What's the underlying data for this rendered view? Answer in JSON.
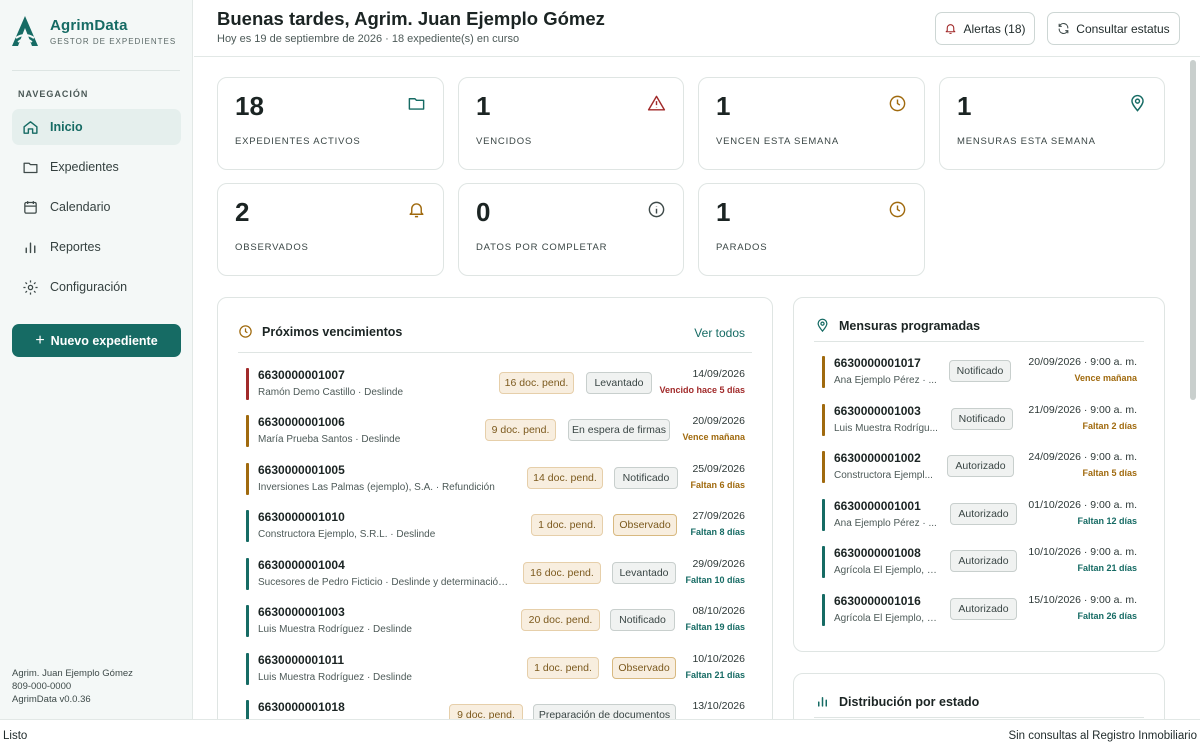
{
  "brand": {
    "name": "AgrimData",
    "subtitle": "GESTOR DE EXPEDIENTES"
  },
  "nav": {
    "title": "NAVEGACIÓN",
    "items": [
      {
        "label": "Inicio",
        "icon": "home-icon",
        "active": true
      },
      {
        "label": "Expedientes",
        "icon": "folder-icon"
      },
      {
        "label": "Calendario",
        "icon": "calendar-icon"
      },
      {
        "label": "Reportes",
        "icon": "bar-chart-icon"
      },
      {
        "label": "Configuración",
        "icon": "gear-icon"
      }
    ],
    "new_button": "Nuevo expediente"
  },
  "sidebar_footer": {
    "user": "Agrim. Juan Ejemplo Gómez",
    "phone": "809-000-0000",
    "version": "AgrimData v0.0.36"
  },
  "header": {
    "greeting": "Buenas tardes, Agrim. Juan Ejemplo Gómez",
    "subtitle": "Hoy es 19 de septiembre de 2026 · 18 expediente(s) en curso",
    "alerts_button": "Alertas (18)",
    "status_button": "Consultar estatus"
  },
  "stats": [
    {
      "value": "18",
      "label": "EXPEDIENTES ACTIVOS",
      "icon": "folder-icon"
    },
    {
      "value": "1",
      "label": "VENCIDOS",
      "icon": "warning-icon"
    },
    {
      "value": "1",
      "label": "VENCEN ESTA SEMANA",
      "icon": "clock-icon"
    },
    {
      "value": "1",
      "label": "MENSURAS ESTA SEMANA",
      "icon": "map-pin-icon"
    },
    {
      "value": "2",
      "label": "OBSERVADOS",
      "icon": "bell-icon"
    },
    {
      "value": "0",
      "label": "DATOS POR COMPLETAR",
      "icon": "info-icon"
    },
    {
      "value": "1",
      "label": "PARADOS",
      "icon": "clock-icon"
    }
  ],
  "upcoming": {
    "title": "Próximos vencimientos",
    "link": "Ver todos",
    "rows": [
      {
        "code": "6630000001007",
        "desc": "Ramón Demo Castillo · Deslinde",
        "docs": "16 doc. pend.",
        "state": "Levantado",
        "date": "14/09/2026",
        "due": "Vencido hace 5 días",
        "tone": "red"
      },
      {
        "code": "6630000001006",
        "desc": "María Prueba Santos · Deslinde",
        "docs": "9 doc. pend.",
        "state": "En espera de firmas",
        "date": "20/09/2026",
        "due": "Vence mañana",
        "tone": "amber"
      },
      {
        "code": "6630000001005",
        "desc": "Inversiones Las Palmas (ejemplo), S.A. · Refundición",
        "docs": "14 doc. pend.",
        "state": "Notificado",
        "date": "25/09/2026",
        "due": "Faltan 6 días",
        "tone": "amber"
      },
      {
        "code": "6630000001010",
        "desc": "Constructora Ejemplo, S.R.L. · Deslinde",
        "docs": "1 doc. pend.",
        "state": "Observado",
        "date": "27/09/2026",
        "due": "Faltan 8 días",
        "tone": "teal"
      },
      {
        "code": "6630000001004",
        "desc": "Sucesores de Pedro Ficticio · Deslinde y determinación ...",
        "docs": "16 doc. pend.",
        "state": "Levantado",
        "date": "29/09/2026",
        "due": "Faltan 10 días",
        "tone": "teal"
      },
      {
        "code": "6630000001003",
        "desc": "Luis Muestra Rodríguez · Deslinde",
        "docs": "20 doc. pend.",
        "state": "Notificado",
        "date": "08/10/2026",
        "due": "Faltan 19 días",
        "tone": "teal"
      },
      {
        "code": "6630000001011",
        "desc": "Luis Muestra Rodríguez · Deslinde",
        "docs": "1 doc. pend.",
        "state": "Observado",
        "date": "10/10/2026",
        "due": "Faltan 21 días",
        "tone": "teal"
      },
      {
        "code": "6630000001018",
        "desc": "",
        "docs": "9 doc. pend.",
        "state": "Preparación de documentos",
        "date": "13/10/2026",
        "due": "",
        "tone": "teal"
      }
    ]
  },
  "surveys": {
    "title": "Mensuras programadas",
    "rows": [
      {
        "code": "6630000001017",
        "desc": "Ana Ejemplo Pérez · ...",
        "state": "Notificado",
        "date": "20/09/2026 · 9:00 a. m.",
        "due": "Vence mañana",
        "tone": "amber"
      },
      {
        "code": "6630000001003",
        "desc": "Luis Muestra Rodrígu...",
        "state": "Notificado",
        "date": "21/09/2026 · 9:00 a. m.",
        "due": "Faltan 2 días",
        "tone": "amber"
      },
      {
        "code": "6630000001002",
        "desc": "Constructora Ejempl...",
        "state": "Autorizado",
        "date": "24/09/2026 · 9:00 a. m.",
        "due": "Faltan 5 días",
        "tone": "amber"
      },
      {
        "code": "6630000001001",
        "desc": "Ana Ejemplo Pérez · ...",
        "state": "Autorizado",
        "date": "01/10/2026 · 9:00 a. m.",
        "due": "Faltan 12 días",
        "tone": "teal"
      },
      {
        "code": "6630000001008",
        "desc": "Agrícola El Ejemplo, S...",
        "state": "Autorizado",
        "date": "10/10/2026 · 9:00 a. m.",
        "due": "Faltan 21 días",
        "tone": "teal"
      },
      {
        "code": "6630000001016",
        "desc": "Agrícola El Ejemplo, S...",
        "state": "Autorizado",
        "date": "15/10/2026 · 9:00 a. m.",
        "due": "Faltan 26 días",
        "tone": "teal"
      }
    ]
  },
  "distribution": {
    "title": "Distribución por estado"
  },
  "statusbar": {
    "left": "Listo",
    "right": "Sin consultas al Registro Inmobiliario"
  },
  "colors": {
    "brand": "#166b64",
    "danger": "#a12a2a",
    "warning": "#a06a0e"
  }
}
